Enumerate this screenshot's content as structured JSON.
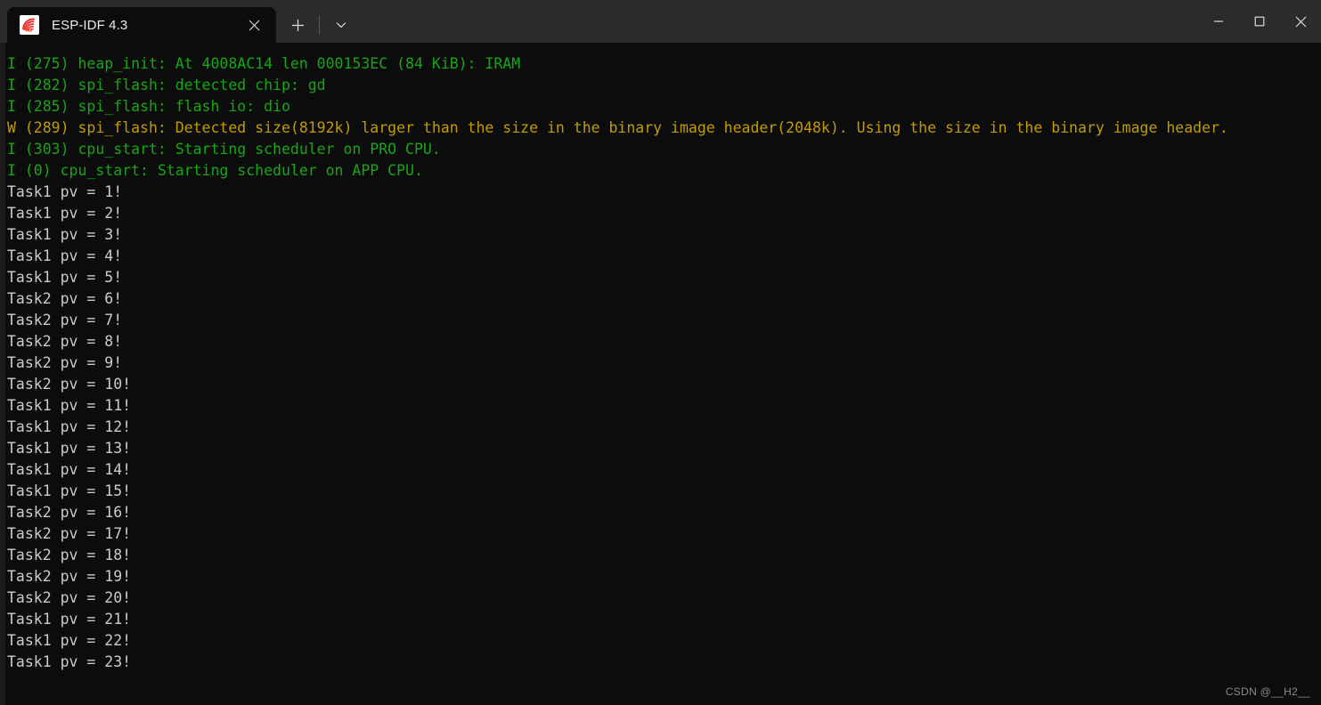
{
  "window": {
    "app_title": "ESP-IDF 4.3",
    "favicon_name": "espressif-logo-icon",
    "colors": {
      "titlebar_bg": "#2b2b2b",
      "terminal_bg": "#0c0c0c",
      "info_green": "#16a616",
      "warn_yellow": "#c19c00",
      "plain_gray": "#cccccc",
      "accent_red": "#e8352e"
    },
    "controls": {
      "minimize_label": "─",
      "maximize_label": "□",
      "close_label": "✕"
    }
  },
  "tabbar": {
    "tabs": [
      {
        "title": "ESP-IDF 4.3",
        "close_label": "✕",
        "active": true
      }
    ],
    "new_tab_label": "+",
    "dropdown_label": "⌄"
  },
  "terminal": {
    "lines": [
      {
        "level": "I",
        "text": "I (275) heap_init: At 4008AC14 len 000153EC (84 KiB): IRAM"
      },
      {
        "level": "I",
        "text": "I (282) spi_flash: detected chip: gd"
      },
      {
        "level": "I",
        "text": "I (285) spi_flash: flash io: dio"
      },
      {
        "level": "W",
        "text": "W (289) spi_flash: Detected size(8192k) larger than the size in the binary image header(2048k). Using the size in the binary image header."
      },
      {
        "level": "I",
        "text": "I (303) cpu_start: Starting scheduler on PRO CPU."
      },
      {
        "level": "I",
        "text": "I (0) cpu_start: Starting scheduler on APP CPU."
      },
      {
        "level": "P",
        "text": "Task1 pv = 1!"
      },
      {
        "level": "P",
        "text": "Task1 pv = 2!"
      },
      {
        "level": "P",
        "text": "Task1 pv = 3!"
      },
      {
        "level": "P",
        "text": "Task1 pv = 4!"
      },
      {
        "level": "P",
        "text": "Task1 pv = 5!"
      },
      {
        "level": "P",
        "text": "Task2 pv = 6!"
      },
      {
        "level": "P",
        "text": "Task2 pv = 7!"
      },
      {
        "level": "P",
        "text": "Task2 pv = 8!"
      },
      {
        "level": "P",
        "text": "Task2 pv = 9!"
      },
      {
        "level": "P",
        "text": "Task2 pv = 10!"
      },
      {
        "level": "P",
        "text": "Task1 pv = 11!"
      },
      {
        "level": "P",
        "text": "Task1 pv = 12!"
      },
      {
        "level": "P",
        "text": "Task1 pv = 13!"
      },
      {
        "level": "P",
        "text": "Task1 pv = 14!"
      },
      {
        "level": "P",
        "text": "Task1 pv = 15!"
      },
      {
        "level": "P",
        "text": "Task2 pv = 16!"
      },
      {
        "level": "P",
        "text": "Task2 pv = 17!"
      },
      {
        "level": "P",
        "text": "Task2 pv = 18!"
      },
      {
        "level": "P",
        "text": "Task2 pv = 19!"
      },
      {
        "level": "P",
        "text": "Task2 pv = 20!"
      },
      {
        "level": "P",
        "text": "Task1 pv = 21!"
      },
      {
        "level": "P",
        "text": "Task1 pv = 22!"
      },
      {
        "level": "P",
        "text": "Task1 pv = 23!"
      }
    ]
  },
  "watermark": {
    "text": "CSDN @__H2__"
  }
}
